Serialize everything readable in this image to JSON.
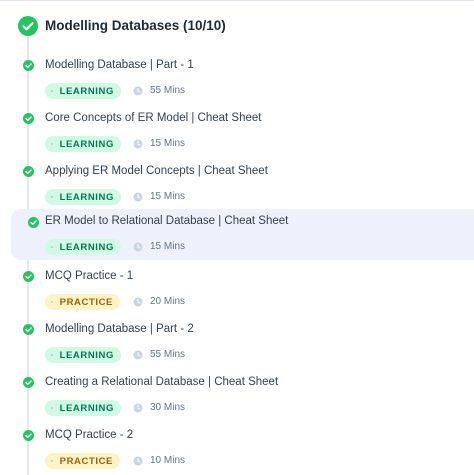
{
  "module": {
    "title": "Modelling Databases (10/10)"
  },
  "items": [
    {
      "title": "Modelling Database | Part - 1",
      "type": "LEARNING",
      "duration": "55 Mins"
    },
    {
      "title": "Core Concepts of ER Model | Cheat Sheet",
      "type": "LEARNING",
      "duration": "15 Mins"
    },
    {
      "title": "Applying ER Model Concepts | Cheat Sheet",
      "type": "LEARNING",
      "duration": "15 Mins"
    },
    {
      "title": "ER Model to Relational Database | Cheat Sheet",
      "type": "LEARNING",
      "duration": "15 Mins",
      "active": true
    },
    {
      "title": "MCQ Practice - 1",
      "type": "PRACTICE",
      "duration": "20 Mins"
    },
    {
      "title": "Modelling Database | Part - 2",
      "type": "LEARNING",
      "duration": "55 Mins"
    },
    {
      "title": "Creating a Relational Database | Cheat Sheet",
      "type": "LEARNING",
      "duration": "30 Mins"
    },
    {
      "title": "MCQ Practice - 2",
      "type": "PRACTICE",
      "duration": "10 Mins"
    }
  ],
  "colors": {
    "complete": "#22c55e",
    "learning_bg": "#d1fae5",
    "learning_text": "#047857",
    "practice_bg": "#fef3c7",
    "practice_text": "#a16207",
    "active_bg": "#eef0fb"
  },
  "icons": {
    "complete": "check-circle-icon",
    "learning": "book-open-icon",
    "practice": "clipboard-icon",
    "duration": "clock-icon"
  }
}
